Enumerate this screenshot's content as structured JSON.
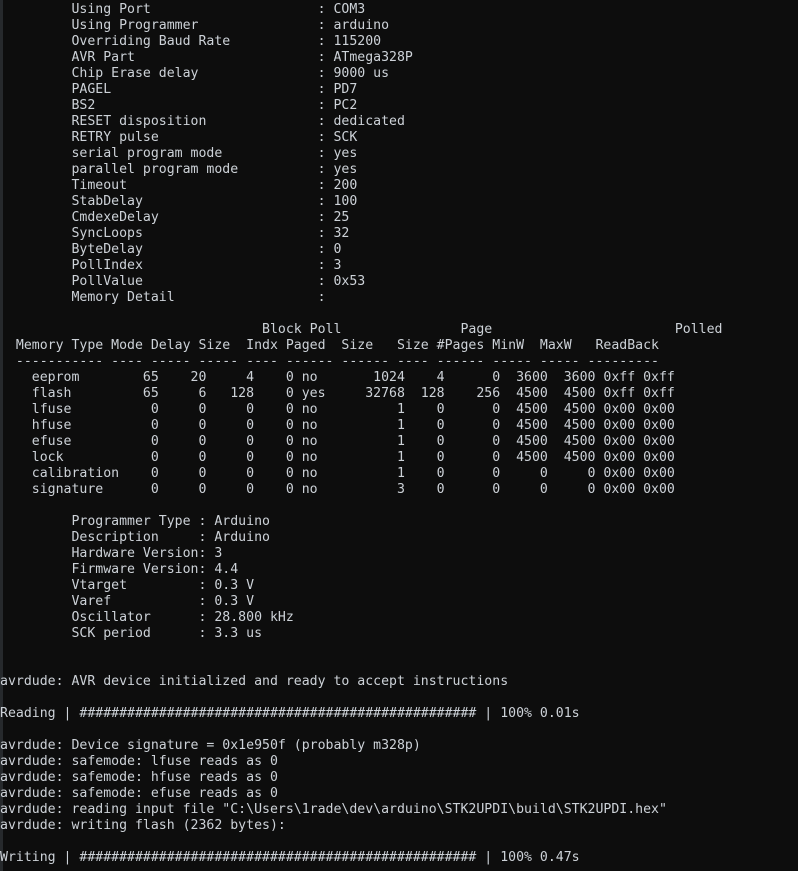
{
  "terminal": {
    "background_color": "#0d0d0d",
    "text_color": "#cdd2d8",
    "border_color": "#26292c",
    "program": "avrdude",
    "port": "COM3",
    "programmer": "arduino",
    "part": "ATmega328P"
  },
  "part_parameters": {
    "indent": 9,
    "value_column": 40,
    "rows": [
      {
        "label": "Using Port",
        "value": "COM3"
      },
      {
        "label": "Using Programmer",
        "value": "arduino"
      },
      {
        "label": "Overriding Baud Rate",
        "value": "115200"
      },
      {
        "label": "AVR Part",
        "value": "ATmega328P"
      },
      {
        "label": "Chip Erase delay",
        "value": "9000 us"
      },
      {
        "label": "PAGEL",
        "value": "PD7"
      },
      {
        "label": "BS2",
        "value": "PC2"
      },
      {
        "label": "RESET disposition",
        "value": "dedicated"
      },
      {
        "label": "RETRY pulse",
        "value": "SCK"
      },
      {
        "label": "serial program mode",
        "value": "yes"
      },
      {
        "label": "parallel program mode",
        "value": "yes"
      },
      {
        "label": "Timeout",
        "value": "200"
      },
      {
        "label": "StabDelay",
        "value": "100"
      },
      {
        "label": "CmdexeDelay",
        "value": "25"
      },
      {
        "label": "SyncLoops",
        "value": "32"
      },
      {
        "label": "ByteDelay",
        "value": "0"
      },
      {
        "label": "PollIndex",
        "value": "3"
      },
      {
        "label": "PollValue",
        "value": "0x53"
      },
      {
        "label": "Memory Detail",
        "value": ""
      }
    ]
  },
  "memory_table": {
    "header_line_1": "                                 Block Poll               Page                       Polled",
    "header_line_2": "  Memory Type Mode Delay Size  Indx Paged  Size   Size #Pages MinW  MaxW   ReadBack",
    "separator_line": "  ----------- ---- ----- ----- ---- ------ ------ ---- ------ ----- ----- ---------",
    "columns": [
      "Memory Type",
      "Mode",
      "Delay",
      "Block Size",
      "Poll Indx",
      "Paged",
      "Size",
      "Page Size",
      "#Pages",
      "MinW",
      "MaxW",
      "Polled ReadBack"
    ],
    "rows": [
      {
        "memory": "eeprom",
        "mode": "65",
        "delay": "20",
        "block_size": "4",
        "poll_indx": "0",
        "paged": "no",
        "size": "1024",
        "page_size": "4",
        "pages": "0",
        "minw": "3600",
        "maxw": "3600",
        "readback": "0xff 0xff"
      },
      {
        "memory": "flash",
        "mode": "65",
        "delay": "6",
        "block_size": "128",
        "poll_indx": "0",
        "paged": "yes",
        "size": "32768",
        "page_size": "128",
        "pages": "256",
        "minw": "4500",
        "maxw": "4500",
        "readback": "0xff 0xff"
      },
      {
        "memory": "lfuse",
        "mode": "0",
        "delay": "0",
        "block_size": "0",
        "poll_indx": "0",
        "paged": "no",
        "size": "1",
        "page_size": "0",
        "pages": "0",
        "minw": "4500",
        "maxw": "4500",
        "readback": "0x00 0x00"
      },
      {
        "memory": "hfuse",
        "mode": "0",
        "delay": "0",
        "block_size": "0",
        "poll_indx": "0",
        "paged": "no",
        "size": "1",
        "page_size": "0",
        "pages": "0",
        "minw": "4500",
        "maxw": "4500",
        "readback": "0x00 0x00"
      },
      {
        "memory": "efuse",
        "mode": "0",
        "delay": "0",
        "block_size": "0",
        "poll_indx": "0",
        "paged": "no",
        "size": "1",
        "page_size": "0",
        "pages": "0",
        "minw": "4500",
        "maxw": "4500",
        "readback": "0x00 0x00"
      },
      {
        "memory": "lock",
        "mode": "0",
        "delay": "0",
        "block_size": "0",
        "poll_indx": "0",
        "paged": "no",
        "size": "1",
        "page_size": "0",
        "pages": "0",
        "minw": "4500",
        "maxw": "4500",
        "readback": "0x00 0x00"
      },
      {
        "memory": "calibration",
        "mode": "0",
        "delay": "0",
        "block_size": "0",
        "poll_indx": "0",
        "paged": "no",
        "size": "1",
        "page_size": "0",
        "pages": "0",
        "minw": "0",
        "maxw": "0",
        "readback": "0x00 0x00"
      },
      {
        "memory": "signature",
        "mode": "0",
        "delay": "0",
        "block_size": "0",
        "poll_indx": "0",
        "paged": "no",
        "size": "3",
        "page_size": "0",
        "pages": "0",
        "minw": "0",
        "maxw": "0",
        "readback": "0x00 0x00"
      }
    ],
    "rendered_rows": [
      "    eeprom        65    20     4    0 no       1024    4      0  3600  3600 0xff 0xff",
      "    flash         65     6   128    0 yes     32768  128    256  4500  4500 0xff 0xff",
      "    lfuse          0     0     0    0 no          1    0      0  4500  4500 0x00 0x00",
      "    hfuse          0     0     0    0 no          1    0      0  4500  4500 0x00 0x00",
      "    efuse          0     0     0    0 no          1    0      0  4500  4500 0x00 0x00",
      "    lock           0     0     0    0 no          1    0      0  4500  4500 0x00 0x00",
      "    calibration    0     0     0    0 no          1    0      0     0     0 0x00 0x00",
      "    signature      0     0     0    0 no          3    0      0     0     0 0x00 0x00"
    ]
  },
  "programmer_info": {
    "indent": 9,
    "rows": [
      {
        "label": "Programmer Type ",
        "value": "Arduino"
      },
      {
        "label": "Description     ",
        "value": "Arduino"
      },
      {
        "label": "Hardware Version",
        "value": "3"
      },
      {
        "label": "Firmware Version",
        "value": "4.4"
      },
      {
        "label": "Vtarget         ",
        "value": "0.3 V"
      },
      {
        "label": "Varef           ",
        "value": "0.3 V"
      },
      {
        "label": "Oscillator      ",
        "value": "28.800 kHz"
      },
      {
        "label": "SCK period      ",
        "value": "3.3 us"
      }
    ]
  },
  "messages": {
    "device_ready": "avrdude: AVR device initialized and ready to accept instructions",
    "device_signature": "avrdude: Device signature = 0x1e950f (probably m328p)",
    "safemode_lfuse": "avrdude: safemode: lfuse reads as 0",
    "safemode_hfuse": "avrdude: safemode: hfuse reads as 0",
    "safemode_efuse": "avrdude: safemode: efuse reads as 0",
    "reading_input_file": "avrdude: reading input file \"C:\\Users\\1rade\\dev\\arduino\\STK2UPDI\\build\\STK2UPDI.hex\"",
    "writing_flash": "avrdude: writing flash (2362 bytes):"
  },
  "progress_bars": [
    {
      "label": "Reading",
      "bar": "##################################################",
      "percent": "100%",
      "elapsed": "0.01s",
      "line": "Reading | ################################################## | 100% 0.01s"
    },
    {
      "label": "Writing",
      "bar": "##################################################",
      "percent": "100%",
      "elapsed": "0.47s",
      "line": "Writing | ################################################## | 100% 0.47s"
    }
  ]
}
